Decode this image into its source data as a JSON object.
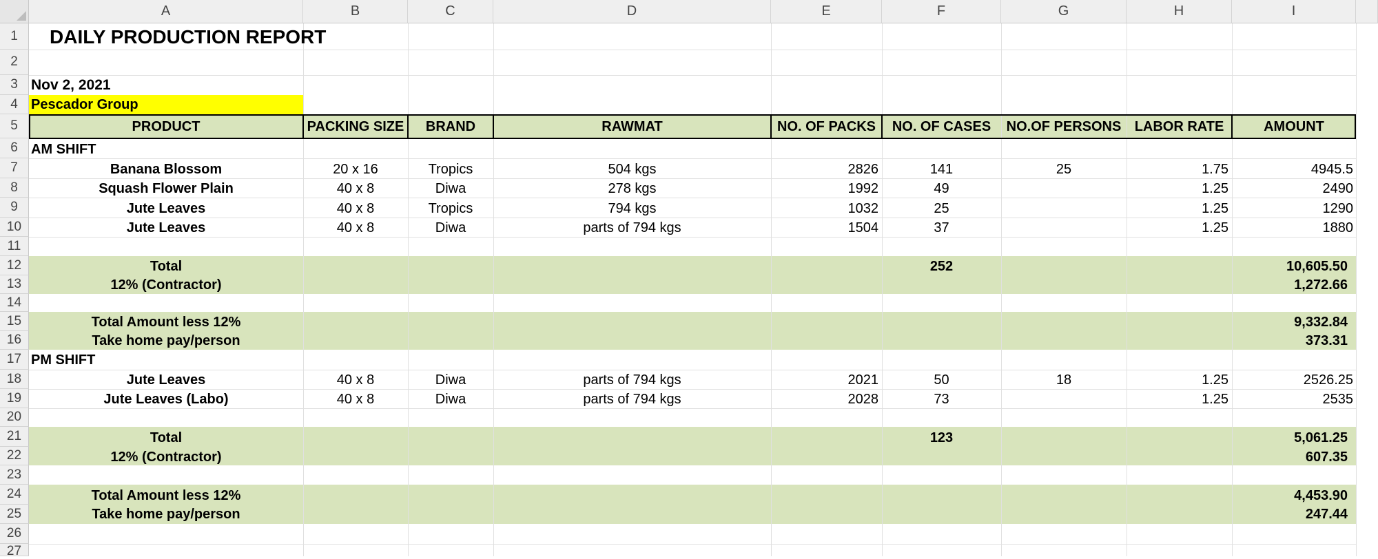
{
  "columns": [
    "A",
    "B",
    "C",
    "D",
    "E",
    "F",
    "G",
    "H",
    "I"
  ],
  "rows": [
    "1",
    "2",
    "3",
    "4",
    "5",
    "6",
    "7",
    "8",
    "9",
    "10",
    "11",
    "12",
    "13",
    "14",
    "15",
    "16",
    "17",
    "18",
    "19",
    "20",
    "21",
    "22",
    "23",
    "24",
    "25",
    "26",
    "27"
  ],
  "report": {
    "title": "DAILY PRODUCTION REPORT",
    "date": "Nov 2, 2021",
    "group": "Pescador Group"
  },
  "headers": [
    "PRODUCT",
    "PACKING SIZE",
    "BRAND",
    "RAWMAT",
    "NO. OF PACKS",
    "NO. OF CASES",
    "NO.OF PERSONS",
    "LABOR RATE",
    "AMOUNT"
  ],
  "colors": {
    "accent_green": "#d8e4bc",
    "highlight_yellow": "#ffff00"
  },
  "am_shift": {
    "label": "AM SHIFT",
    "items": [
      {
        "product": "Banana Blossom",
        "size": "20 x 16",
        "brand": "Tropics",
        "rawmat": "504 kgs",
        "packs": "2826",
        "cases": "141",
        "persons": "25",
        "rate": "1.75",
        "amount": "4945.5"
      },
      {
        "product": "Squash Flower Plain",
        "size": "40 x 8",
        "brand": "Diwa",
        "rawmat": "278 kgs",
        "packs": "1992",
        "cases": "49",
        "persons": "",
        "rate": "1.25",
        "amount": "2490"
      },
      {
        "product": "Jute Leaves",
        "size": "40 x 8",
        "brand": "Tropics",
        "rawmat": "794 kgs",
        "packs": "1032",
        "cases": "25",
        "persons": "",
        "rate": "1.25",
        "amount": "1290"
      },
      {
        "product": "Jute Leaves",
        "size": "40 x 8",
        "brand": "Diwa",
        "rawmat": "parts of 794 kgs",
        "packs": "1504",
        "cases": "37",
        "persons": "",
        "rate": "1.25",
        "amount": "1880"
      }
    ],
    "total_label": "Total",
    "total_cases": "252",
    "total_amount": "10,605.50",
    "contractor_label": "12% (Contractor)",
    "contractor_amount": "1,272.66",
    "less_label": "Total Amount less 12%",
    "less_amount": "9,332.84",
    "takehome_label": "Take home pay/person",
    "takehome_amount": "373.31"
  },
  "pm_shift": {
    "label": "PM SHIFT",
    "items": [
      {
        "product": "Jute Leaves",
        "size": "40 x 8",
        "brand": "Diwa",
        "rawmat": "parts of 794 kgs",
        "packs": "2021",
        "cases": "50",
        "persons": "18",
        "rate": "1.25",
        "amount": "2526.25"
      },
      {
        "product": "Jute Leaves (Labo)",
        "size": "40 x 8",
        "brand": "Diwa",
        "rawmat": "parts of 794 kgs",
        "packs": "2028",
        "cases": "73",
        "persons": "",
        "rate": "1.25",
        "amount": "2535"
      }
    ],
    "total_label": "Total",
    "total_cases": "123",
    "total_amount": "5,061.25",
    "contractor_label": "12% (Contractor)",
    "contractor_amount": "607.35",
    "less_label": "Total Amount less 12%",
    "less_amount": "4,453.90",
    "takehome_label": "Take home pay/person",
    "takehome_amount": "247.44"
  }
}
